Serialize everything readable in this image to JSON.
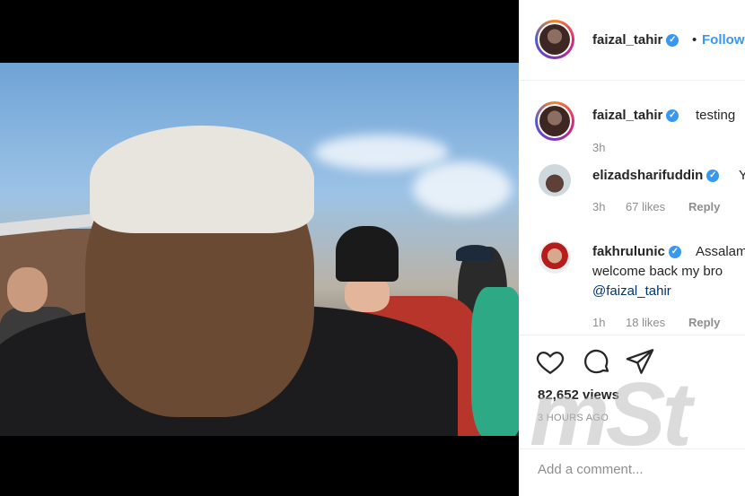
{
  "post": {
    "author": "faizal_tahir",
    "follow_label": "Follow",
    "separator": "•"
  },
  "comments": [
    {
      "user": "faizal_tahir",
      "text": "testing",
      "time": "3h",
      "verified": true
    },
    {
      "user": "elizadsharifuddin",
      "text": "Y",
      "time": "3h",
      "likes": "67 likes",
      "reply": "Reply",
      "verified": true
    },
    {
      "user": "fakhrulunic",
      "text": "Assalam",
      "text2": "welcome back my bro",
      "mention": "@faizal_tahir",
      "time": "1h",
      "likes": "18 likes",
      "reply": "Reply",
      "verified": true
    }
  ],
  "actions": {
    "like_icon": "heart-icon",
    "comment_icon": "comment-icon",
    "share_icon": "share-icon"
  },
  "stats": {
    "views": "82,652 views",
    "posted": "3 HOURS AGO"
  },
  "add_comment": {
    "placeholder": "Add a comment..."
  },
  "watermark": "mSt",
  "colors": {
    "link_blue": "#3897f0",
    "text": "#262626",
    "muted": "#8e8e8e"
  }
}
